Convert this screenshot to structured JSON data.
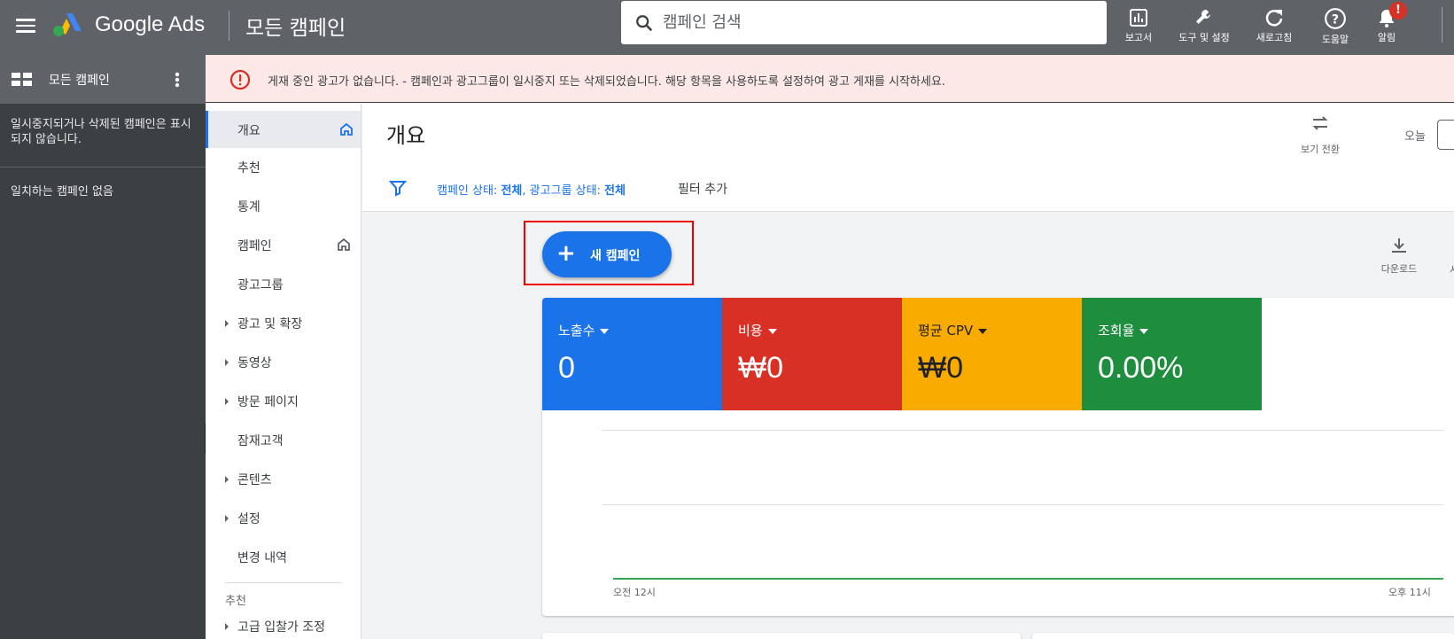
{
  "topbar": {
    "brand": "Google Ads",
    "page_heading": "모든 캠페인",
    "search_placeholder": "캠페인 검색",
    "tools": [
      {
        "label": "보고서",
        "icon": "bar-chart-icon"
      },
      {
        "label": "도구 및 설정",
        "icon": "wrench-icon"
      },
      {
        "label": "새로고침",
        "icon": "refresh-icon"
      },
      {
        "label": "도움말",
        "icon": "help-icon"
      },
      {
        "label": "알림",
        "icon": "bell-icon",
        "badge": "!"
      }
    ]
  },
  "left_panel": {
    "title": "모든 캠페인",
    "message_paused": "일시중지되거나 삭제된 캠페인은 표시되지 않습니다.",
    "message_empty": "일치하는 캠페인 없음"
  },
  "alert": {
    "text": "게재 중인 광고가 없습니다. - 캠페인과 광고그룹이 일시중지 또는 삭제되었습니다. 해당 항목을 사용하도록 설정하여 광고 게재를 시작하세요."
  },
  "nav": {
    "items": [
      {
        "label": "개요",
        "active": true,
        "home": true
      },
      {
        "label": "추천"
      },
      {
        "label": "통계"
      },
      {
        "label": "캠페인",
        "home": true
      },
      {
        "label": "광고그룹"
      },
      {
        "label": "광고 및 확장",
        "expandable": true
      },
      {
        "label": "동영상",
        "expandable": true
      },
      {
        "label": "방문 페이지",
        "expandable": true
      },
      {
        "label": "잠재고객"
      },
      {
        "label": "콘텐츠",
        "expandable": true
      },
      {
        "label": "설정",
        "expandable": true
      },
      {
        "label": "변경 내역"
      }
    ],
    "section_title": "추천",
    "section_item": "고급 입찰가 조정"
  },
  "main": {
    "title": "개요",
    "view_switch": "보기 전환",
    "today_label": "오늘",
    "filter": {
      "campaign_status_label": "캠페인 상태: ",
      "campaign_status_value": "전체",
      "adgroup_status_label": ", 광고그룹 상태: ",
      "adgroup_status_value": "전체",
      "add_filter": "필터 추가"
    },
    "new_campaign": "새 캠페인",
    "download": "다운로드",
    "cut_text": "시"
  },
  "metrics": [
    {
      "label": "노출수",
      "value": "0",
      "color": "#1a73e8"
    },
    {
      "label": "비용",
      "value": "₩0",
      "color": "#d93025"
    },
    {
      "label": "평균 CPV",
      "value": "₩0",
      "color": "#f9ab00"
    },
    {
      "label": "조회율",
      "value": "0.00%",
      "color": "#1e8e3e"
    }
  ],
  "chart_data": {
    "type": "line",
    "x": [
      "오전 12시",
      "오후 11시"
    ],
    "series": [
      {
        "values": [
          0,
          0
        ],
        "color": "#34a853"
      }
    ]
  }
}
